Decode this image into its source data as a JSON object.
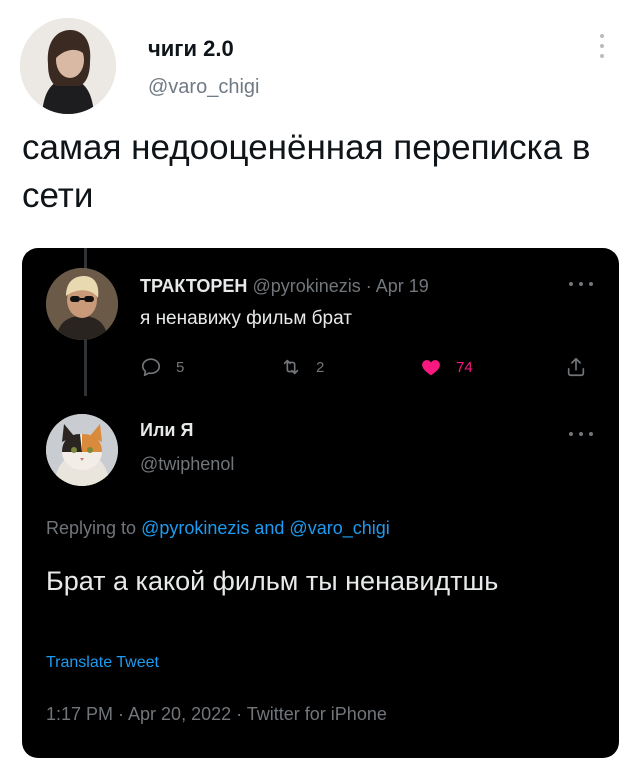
{
  "outer_tweet": {
    "author": {
      "name": "чиги 2.0",
      "handle": "@varo_chigi"
    },
    "more_icon": "vertical-dots-icon",
    "text": "самая недооценённая переписка в сети"
  },
  "embedded": {
    "theme": {
      "background": "#000000",
      "accent": "#1d9bf0",
      "like": "#f91880"
    },
    "tweet1": {
      "name": "ТРАКТОРЕН",
      "handle": "@pyrokinezis",
      "separator": " · ",
      "date": "Apr 19",
      "text": "я ненавижу фильм брат",
      "actions": {
        "reply": {
          "icon": "reply-icon",
          "count": "5"
        },
        "retweet": {
          "icon": "retweet-icon",
          "count": "2"
        },
        "like": {
          "icon": "heart-filled-icon",
          "count": "74"
        },
        "share": {
          "icon": "share-icon"
        }
      }
    },
    "tweet2": {
      "name": "Или Я",
      "handle": "@twiphenol",
      "replying_prefix": "Replying to ",
      "replying_to_1": "@pyrokinezis",
      "replying_and": " and ",
      "replying_to_2": "@varo_chigi",
      "text": "Брат а какой фильм ты ненавидтшь",
      "translate_label": "Translate Tweet",
      "timestamp": "1:17 PM · Apr 20, 2022 · Twitter for iPhone"
    }
  }
}
